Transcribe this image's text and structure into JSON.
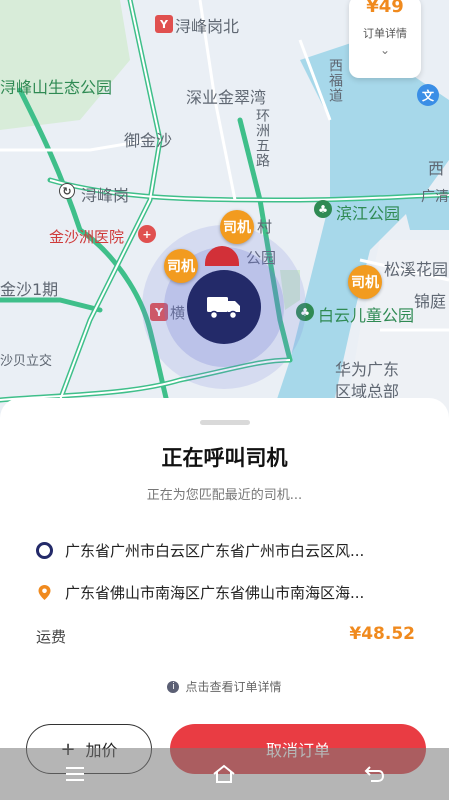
{
  "map": {
    "labels": {
      "xunfenggang_north": "浔峰岗北",
      "xunfengshan_park": "浔峰山生态公园",
      "shenye_jincuiwan": "深业金翠湾",
      "yujinsha": "御金沙",
      "xunfenggang": "浔峰岗",
      "jinshazhou_hospital": "金沙洲医院",
      "binjiang_park": "滨江公园",
      "guangqing": "广清",
      "xi": "西",
      "songxi_garden": "松溪花园",
      "jinfeng": "锦庭",
      "jinsha_phase1": "金沙1期",
      "baiyun_children_park": "白云儿童公园",
      "shabei_interchange": "沙贝立交",
      "huawei_line1": "华为广东",
      "huawei_line2": "区域总部",
      "huanzhou_5th_road": "环洲五路",
      "xifu_road": "西福道",
      "cun": "村",
      "gongyuan": "公园",
      "heng": "横"
    },
    "driver_badge_label": "司机"
  },
  "order_float": {
    "price": "¥49",
    "label": "订单详情"
  },
  "sheet": {
    "title": "正在呼叫司机",
    "subtitle": "正在为您匹配最近的司机...",
    "start_address": "广东省广州市白云区广东省广州市白云区风...",
    "end_address": "广东省佛山市南海区广东省佛山市南海区海...",
    "fee_label": "运费",
    "fee_value": "¥48.52",
    "detail_link": "点击查看订单详情",
    "add_price_label": "加价",
    "cancel_label": "取消订单"
  },
  "colors": {
    "accent_red": "#e93c43",
    "price_orange": "#f08a1e",
    "marker_navy": "#232a69",
    "road_green": "#3fbf8a"
  }
}
